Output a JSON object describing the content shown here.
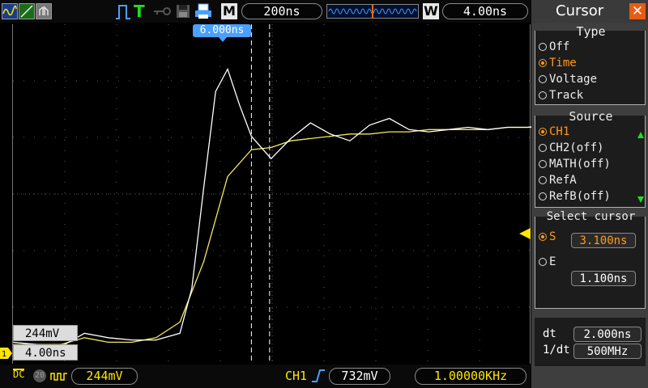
{
  "top_bar": {
    "mode_icon": "dual-waveform-icon",
    "trigger_status": "T",
    "timebase_label": "M",
    "timebase_value": "200ns",
    "window_label": "W",
    "window_value": "4.00ns"
  },
  "plot": {
    "cursor_delta_label": "6.000ns",
    "voltage_box": "244mV",
    "time_box": "4.00ns"
  },
  "bottom_bar": {
    "coupling": "DC",
    "bw_limit": "20",
    "channel_volts": "244mV",
    "trigger_channel": "CH1",
    "trigger_level": "732mV",
    "frequency": "1.00000KHz"
  },
  "menu": {
    "title": "Cursor",
    "type": {
      "heading": "Type",
      "options": [
        "Off",
        "Time",
        "Voltage",
        "Track"
      ],
      "selected": "Time"
    },
    "source": {
      "heading": "Source",
      "options": [
        "CH1",
        "CH2(off)",
        "MATH(off)",
        "RefA",
        "RefB(off)"
      ],
      "selected": "CH1"
    },
    "select_cursor": {
      "heading": "Select cursor",
      "s_label": "S",
      "s_value": "3.100ns",
      "e_label": "E",
      "e_value": "1.100ns"
    },
    "measure": {
      "dt_label": "dt",
      "dt_value": "2.000ns",
      "inv_dt_label": "1/dt",
      "inv_dt_value": "500MHz"
    }
  },
  "colors": {
    "ch1_trace": "#f2e85a",
    "white_trace": "#ffffff",
    "grid": "#5a5a5a",
    "accent_orange": "#ff9a1a",
    "cursor_blue": "#4aa0ff",
    "trigger_green": "#22dd22"
  },
  "chart_data": {
    "type": "line",
    "x_unit": "ns",
    "series": [
      {
        "x": [
          0,
          0.8,
          1.2,
          1.6,
          2.0,
          2.4,
          2.8,
          3.2,
          3.6,
          4.0,
          4.4,
          4.8,
          5.2,
          5.6,
          6.0,
          6.4,
          6.8,
          7.2,
          7.6,
          8.0,
          8.4,
          8.8,
          9.2,
          9.6,
          10.0
        ],
        "y": [
          0.05,
          0.05,
          0.08,
          0.06,
          0.06,
          0.08,
          0.15,
          0.42,
          0.8,
          0.92,
          0.93,
          0.96,
          0.97,
          0.98,
          0.99,
          0.99,
          1.0,
          1.0,
          1.01,
          1.01,
          1.01,
          1.01,
          1.02,
          1.02,
          1.02
        ]
      },
      {
        "x": [
          0,
          0.8,
          1.2,
          1.6,
          2.0,
          2.4,
          2.8,
          3.0,
          3.2,
          3.4,
          3.6,
          3.8,
          4.0,
          4.4,
          4.8,
          5.2,
          5.6,
          6.0,
          6.4,
          6.8,
          7.2,
          7.6,
          8.0,
          8.4,
          8.8,
          9.2,
          9.6,
          10.0
        ],
        "y": [
          0.06,
          0.04,
          0.1,
          0.08,
          0.07,
          0.07,
          0.1,
          0.3,
          0.75,
          1.18,
          1.28,
          1.12,
          0.98,
          0.88,
          0.97,
          1.04,
          0.99,
          0.96,
          1.03,
          1.06,
          1.01,
          1.0,
          1.01,
          1.02,
          1.01,
          1.02,
          1.02,
          1.03
        ]
      }
    ],
    "cursors_ns": [
      3.1,
      1.1
    ],
    "grid": true
  }
}
